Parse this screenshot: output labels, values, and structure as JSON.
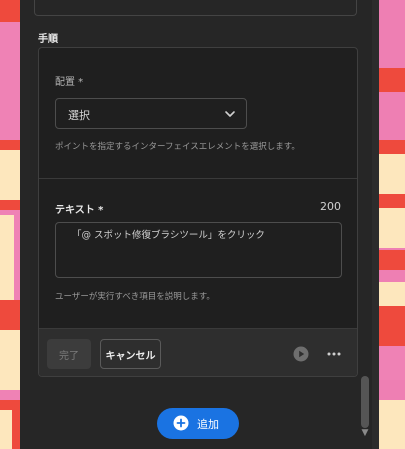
{
  "steps": {
    "heading": "手順"
  },
  "placement": {
    "label": "配置 *",
    "select_value": "選択",
    "helper": "ポイントを指定するインターフェイスエレメントを選択します。"
  },
  "text_field": {
    "label": "テキスト *",
    "char_count": "200",
    "value": "「@ スポット修復ブラシツール」をクリック",
    "helper": "ユーザーが実行すべき項目を説明します。"
  },
  "footer": {
    "done_label": "完了",
    "cancel_label": "キャンセル",
    "play_icon": "play-circle-icon",
    "more_icon": "more-horizontal-icon"
  },
  "add_button": {
    "label": "追加",
    "icon": "plus-circle-icon"
  },
  "colors": {
    "panel_bg": "#262626",
    "accent_blue": "#1a73e2",
    "bg_pink": "#ef82b5",
    "bg_red": "#ee4a3d",
    "bg_cream": "#fde7bd"
  }
}
